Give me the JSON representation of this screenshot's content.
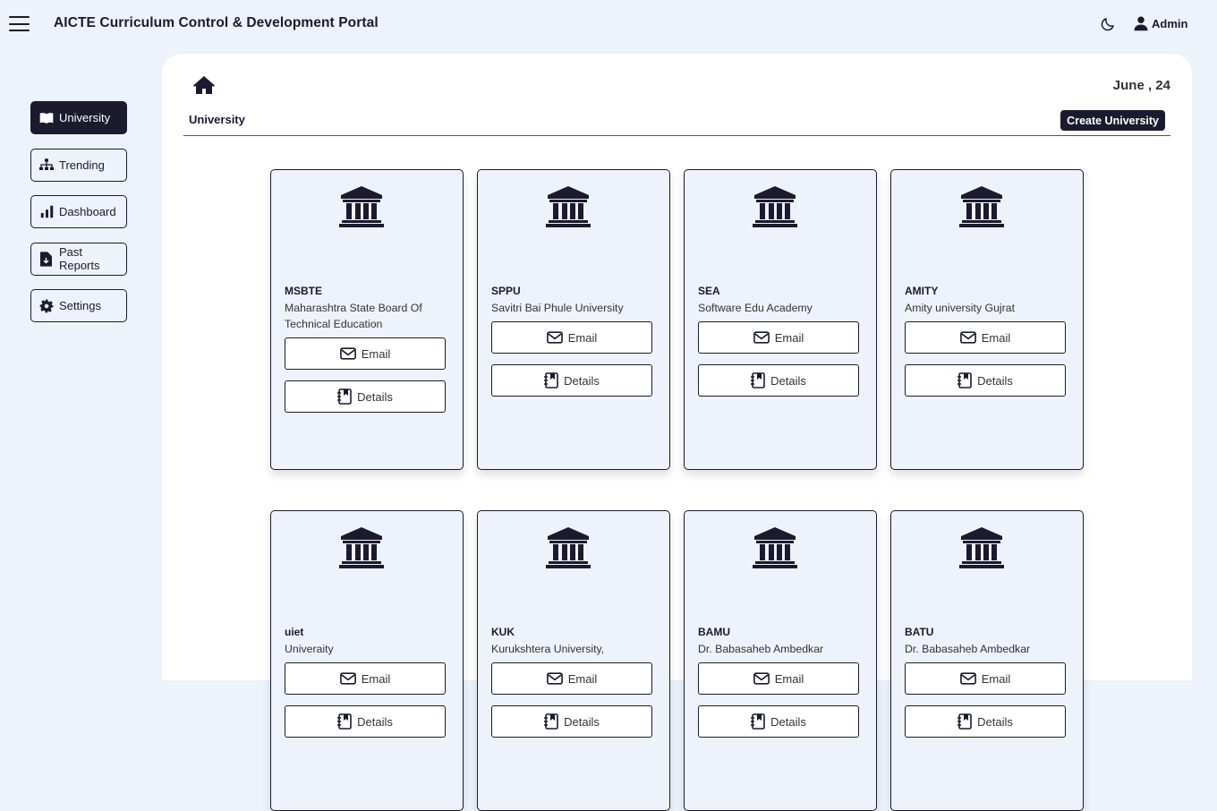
{
  "header": {
    "title": "AICTE Curriculum Control & Development Portal",
    "user_label": "Admin"
  },
  "sidebar": {
    "items": [
      {
        "label": "University",
        "icon": "book-open-icon",
        "active": true
      },
      {
        "label": "Trending",
        "icon": "sitemap-icon",
        "active": false
      },
      {
        "label": "Dashboard",
        "icon": "bar-chart-icon",
        "active": false
      },
      {
        "label": "Past Reports",
        "icon": "file-download-icon",
        "active": false
      },
      {
        "label": "Settings",
        "icon": "gear-icon",
        "active": false
      }
    ]
  },
  "main": {
    "date": "June , 24",
    "section_title": "University",
    "create_button": "Create University",
    "email_label": "Email",
    "details_label": "Details",
    "universities": [
      {
        "code": "MSBTE",
        "name": "Maharashtra State Board Of Technical Education"
      },
      {
        "code": "SPPU",
        "name": "Savitri Bai Phule University"
      },
      {
        "code": "SEA",
        "name": "Software Edu Academy"
      },
      {
        "code": "AMITY",
        "name": "Amity university Gujrat"
      },
      {
        "code": "uiet",
        "name": "Univeraity"
      },
      {
        "code": "KUK",
        "name": "Kurukshtera University,"
      },
      {
        "code": "BAMU",
        "name": "Dr. Babasaheb Ambedkar"
      },
      {
        "code": "BATU",
        "name": "Dr. Babasaheb Ambedkar"
      }
    ]
  }
}
